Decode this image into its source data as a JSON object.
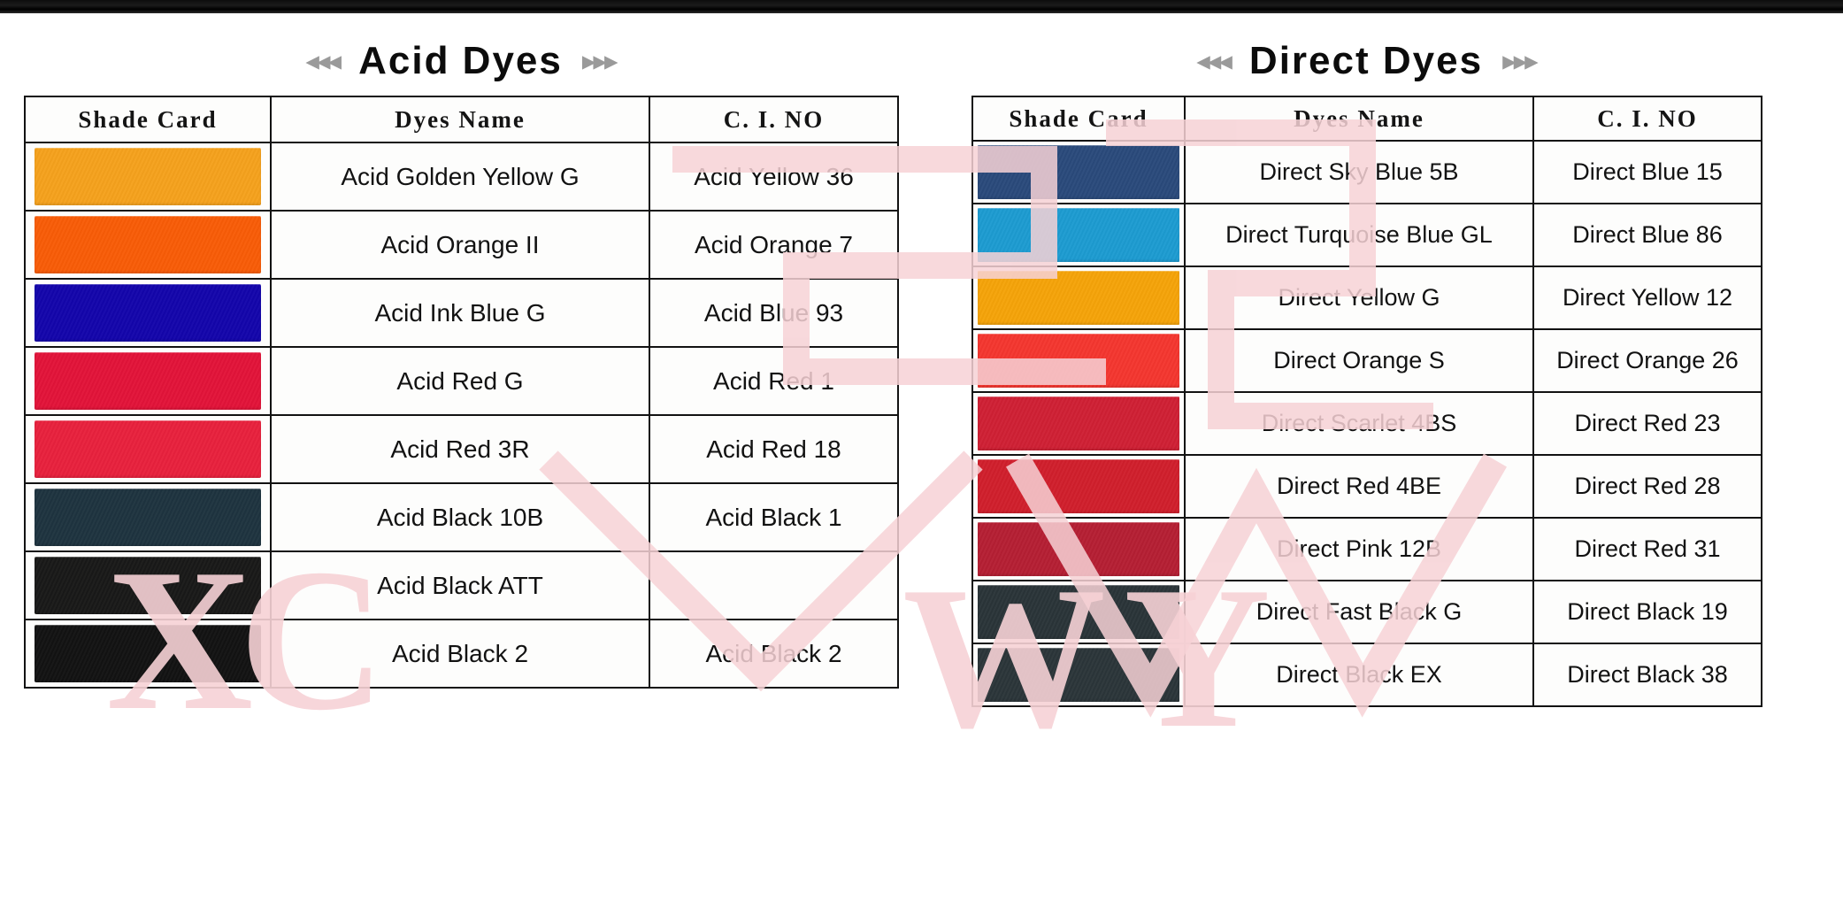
{
  "page": {
    "background_color": "#ffffff",
    "top_bar_color": "#0d0d0d",
    "watermark_text": "XCWY",
    "watermark_color": "#f7d4d7",
    "border_color": "#121212"
  },
  "panels": [
    {
      "id": "acid",
      "title": "Acid Dyes",
      "left_chevrons": "◂◂◂",
      "right_chevrons": "▸▸▸",
      "columns": [
        "Shade Card",
        "Dyes Name",
        "C. I. NO"
      ],
      "rows": [
        {
          "swatch_color": "#f5a11d",
          "name": "Acid Golden Yellow G",
          "ci_no": "Acid Yellow 36"
        },
        {
          "swatch_color": "#f85c07",
          "name": "Acid Orange II",
          "ci_no": "Acid Orange 7"
        },
        {
          "swatch_color": "#1305ab",
          "name": "Acid Ink Blue G",
          "ci_no": "Acid Blue 93"
        },
        {
          "swatch_color": "#e21339",
          "name": "Acid Red G",
          "ci_no": "Acid Red 1"
        },
        {
          "swatch_color": "#e8213d",
          "name": "Acid Red 3R",
          "ci_no": "Acid Red 18"
        },
        {
          "swatch_color": "#1e333f",
          "name": "Acid Black 10B",
          "ci_no": "Acid Black 1"
        },
        {
          "swatch_color": "#191918",
          "name": "Acid Black ATT",
          "ci_no": ""
        },
        {
          "swatch_color": "#121212",
          "name": "Acid Black 2",
          "ci_no": "Acid Black 2"
        }
      ]
    },
    {
      "id": "direct",
      "title": "Direct Dyes",
      "left_chevrons": "◂◂◂",
      "right_chevrons": "▸▸▸",
      "columns": [
        "Shade Card",
        "Dyes Name",
        "C. I. NO"
      ],
      "rows": [
        {
          "swatch_color": "#2a4a7b",
          "name": "Direct Sky Blue 5B",
          "ci_no": "Direct Blue 15"
        },
        {
          "swatch_color": "#1d9bd1",
          "name": "Direct Turquoise Blue GL",
          "ci_no": "Direct Blue 86"
        },
        {
          "swatch_color": "#f5a309",
          "name": "Direct Yellow G",
          "ci_no": "Direct Yellow 12"
        },
        {
          "swatch_color": "#f4362f",
          "name": "Direct Orange S",
          "ci_no": "Direct Orange 26"
        },
        {
          "swatch_color": "#cf2034",
          "name": "Direct Scarlet 4BS",
          "ci_no": "Direct Red 23"
        },
        {
          "swatch_color": "#d01f2c",
          "name": "Direct Red 4BE",
          "ci_no": "Direct Red 28"
        },
        {
          "swatch_color": "#b51f33",
          "name": "Direct Pink 12B",
          "ci_no": "Direct Red 31"
        },
        {
          "swatch_color": "#2a3438",
          "name": "Direct Fast Black G",
          "ci_no": "Direct Black 19"
        },
        {
          "swatch_color": "#2b3539",
          "name": "Direct Black EX",
          "ci_no": "Direct Black 38"
        }
      ]
    }
  ]
}
